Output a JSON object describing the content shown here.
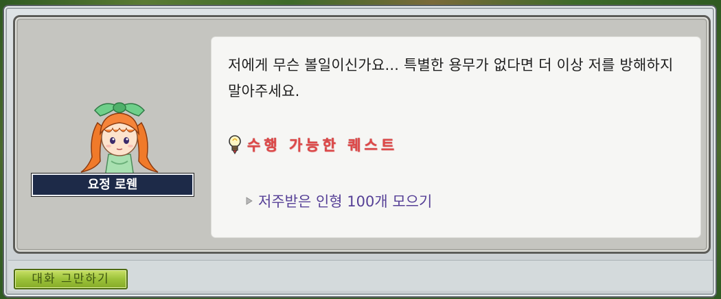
{
  "npc": {
    "name": "요정 로웬"
  },
  "dialog": {
    "text": "저에게 무슨 볼일이신가요... 특별한 용무가 없다면 더 이상 저를 방해하지 말아주세요."
  },
  "quests": {
    "section_title": "수행 가능한 퀘스트",
    "items": [
      {
        "label": "저주받은 인형 100개 모으기"
      }
    ]
  },
  "footer": {
    "end_chat_label": "대화 그만하기"
  },
  "colors": {
    "quest_title": "#e04848",
    "quest_item": "#553f96",
    "end_chat_button": "#9cc23a",
    "npc_name_bg": "#1d2a48"
  },
  "icons": {
    "quest_section": "lightbulb-icon",
    "quest_item": "arrow-right-icon"
  }
}
